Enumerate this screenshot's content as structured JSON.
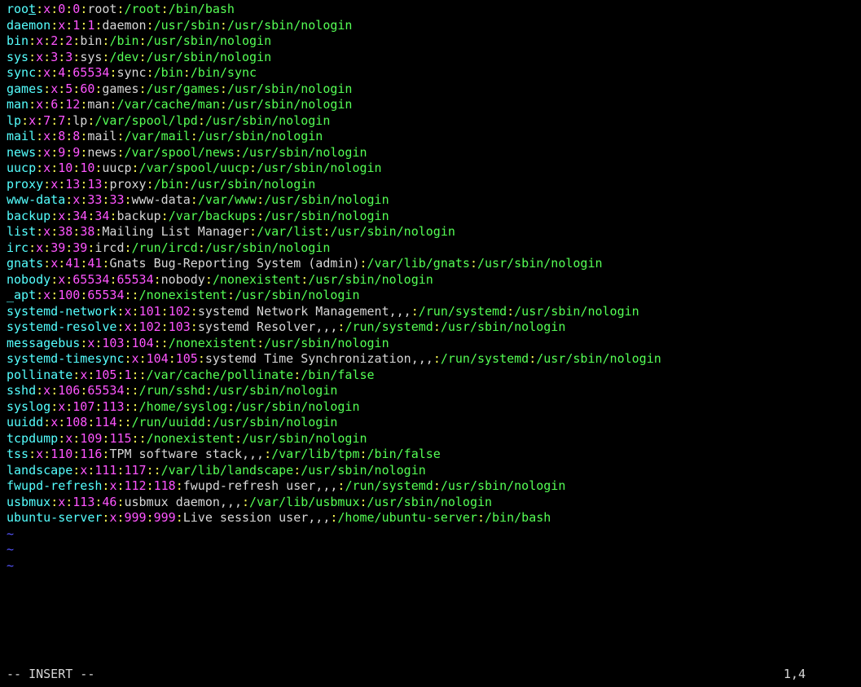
{
  "passwd": [
    {
      "user": "root",
      "pw": "x",
      "uid": "0",
      "gid": "0",
      "gecos": "root",
      "home": "/root",
      "shell": "/bin/bash"
    },
    {
      "user": "daemon",
      "pw": "x",
      "uid": "1",
      "gid": "1",
      "gecos": "daemon",
      "home": "/usr/sbin",
      "shell": "/usr/sbin/nologin"
    },
    {
      "user": "bin",
      "pw": "x",
      "uid": "2",
      "gid": "2",
      "gecos": "bin",
      "home": "/bin",
      "shell": "/usr/sbin/nologin"
    },
    {
      "user": "sys",
      "pw": "x",
      "uid": "3",
      "gid": "3",
      "gecos": "sys",
      "home": "/dev",
      "shell": "/usr/sbin/nologin"
    },
    {
      "user": "sync",
      "pw": "x",
      "uid": "4",
      "gid": "65534",
      "gecos": "sync",
      "home": "/bin",
      "shell": "/bin/sync"
    },
    {
      "user": "games",
      "pw": "x",
      "uid": "5",
      "gid": "60",
      "gecos": "games",
      "home": "/usr/games",
      "shell": "/usr/sbin/nologin"
    },
    {
      "user": "man",
      "pw": "x",
      "uid": "6",
      "gid": "12",
      "gecos": "man",
      "home": "/var/cache/man",
      "shell": "/usr/sbin/nologin"
    },
    {
      "user": "lp",
      "pw": "x",
      "uid": "7",
      "gid": "7",
      "gecos": "lp",
      "home": "/var/spool/lpd",
      "shell": "/usr/sbin/nologin"
    },
    {
      "user": "mail",
      "pw": "x",
      "uid": "8",
      "gid": "8",
      "gecos": "mail",
      "home": "/var/mail",
      "shell": "/usr/sbin/nologin"
    },
    {
      "user": "news",
      "pw": "x",
      "uid": "9",
      "gid": "9",
      "gecos": "news",
      "home": "/var/spool/news",
      "shell": "/usr/sbin/nologin"
    },
    {
      "user": "uucp",
      "pw": "x",
      "uid": "10",
      "gid": "10",
      "gecos": "uucp",
      "home": "/var/spool/uucp",
      "shell": "/usr/sbin/nologin"
    },
    {
      "user": "proxy",
      "pw": "x",
      "uid": "13",
      "gid": "13",
      "gecos": "proxy",
      "home": "/bin",
      "shell": "/usr/sbin/nologin"
    },
    {
      "user": "www-data",
      "pw": "x",
      "uid": "33",
      "gid": "33",
      "gecos": "www-data",
      "home": "/var/www",
      "shell": "/usr/sbin/nologin"
    },
    {
      "user": "backup",
      "pw": "x",
      "uid": "34",
      "gid": "34",
      "gecos": "backup",
      "home": "/var/backups",
      "shell": "/usr/sbin/nologin"
    },
    {
      "user": "list",
      "pw": "x",
      "uid": "38",
      "gid": "38",
      "gecos": "Mailing List Manager",
      "home": "/var/list",
      "shell": "/usr/sbin/nologin"
    },
    {
      "user": "irc",
      "pw": "x",
      "uid": "39",
      "gid": "39",
      "gecos": "ircd",
      "home": "/run/ircd",
      "shell": "/usr/sbin/nologin"
    },
    {
      "user": "gnats",
      "pw": "x",
      "uid": "41",
      "gid": "41",
      "gecos": "Gnats Bug-Reporting System (admin)",
      "home": "/var/lib/gnats",
      "shell": "/usr/sbin/nologin"
    },
    {
      "user": "nobody",
      "pw": "x",
      "uid": "65534",
      "gid": "65534",
      "gecos": "nobody",
      "home": "/nonexistent",
      "shell": "/usr/sbin/nologin"
    },
    {
      "user": "_apt",
      "pw": "x",
      "uid": "100",
      "gid": "65534",
      "gecos": "",
      "home": "/nonexistent",
      "shell": "/usr/sbin/nologin"
    },
    {
      "user": "systemd-network",
      "pw": "x",
      "uid": "101",
      "gid": "102",
      "gecos": "systemd Network Management,,,",
      "home": "/run/systemd",
      "shell": "/usr/sbin/nologin"
    },
    {
      "user": "systemd-resolve",
      "pw": "x",
      "uid": "102",
      "gid": "103",
      "gecos": "systemd Resolver,,,",
      "home": "/run/systemd",
      "shell": "/usr/sbin/nologin"
    },
    {
      "user": "messagebus",
      "pw": "x",
      "uid": "103",
      "gid": "104",
      "gecos": "",
      "home": "/nonexistent",
      "shell": "/usr/sbin/nologin"
    },
    {
      "user": "systemd-timesync",
      "pw": "x",
      "uid": "104",
      "gid": "105",
      "gecos": "systemd Time Synchronization,,,",
      "home": "/run/systemd",
      "shell": "/usr/sbin/nologin"
    },
    {
      "user": "pollinate",
      "pw": "x",
      "uid": "105",
      "gid": "1",
      "gecos": "",
      "home": "/var/cache/pollinate",
      "shell": "/bin/false"
    },
    {
      "user": "sshd",
      "pw": "x",
      "uid": "106",
      "gid": "65534",
      "gecos": "",
      "home": "/run/sshd",
      "shell": "/usr/sbin/nologin"
    },
    {
      "user": "syslog",
      "pw": "x",
      "uid": "107",
      "gid": "113",
      "gecos": "",
      "home": "/home/syslog",
      "shell": "/usr/sbin/nologin"
    },
    {
      "user": "uuidd",
      "pw": "x",
      "uid": "108",
      "gid": "114",
      "gecos": "",
      "home": "/run/uuidd",
      "shell": "/usr/sbin/nologin"
    },
    {
      "user": "tcpdump",
      "pw": "x",
      "uid": "109",
      "gid": "115",
      "gecos": "",
      "home": "/nonexistent",
      "shell": "/usr/sbin/nologin"
    },
    {
      "user": "tss",
      "pw": "x",
      "uid": "110",
      "gid": "116",
      "gecos": "TPM software stack,,,",
      "home": "/var/lib/tpm",
      "shell": "/bin/false"
    },
    {
      "user": "landscape",
      "pw": "x",
      "uid": "111",
      "gid": "117",
      "gecos": "",
      "home": "/var/lib/landscape",
      "shell": "/usr/sbin/nologin"
    },
    {
      "user": "fwupd-refresh",
      "pw": "x",
      "uid": "112",
      "gid": "118",
      "gecos": "fwupd-refresh user,,,",
      "home": "/run/systemd",
      "shell": "/usr/sbin/nologin"
    },
    {
      "user": "usbmux",
      "pw": "x",
      "uid": "113",
      "gid": "46",
      "gecos": "usbmux daemon,,,",
      "home": "/var/lib/usbmux",
      "shell": "/usr/sbin/nologin"
    },
    {
      "user": "ubuntu-server",
      "pw": "x",
      "uid": "999",
      "gid": "999",
      "gecos": "Live session user,,,",
      "home": "/home/ubuntu-server",
      "shell": "/bin/bash"
    }
  ],
  "cursor_row": 0,
  "cursor_col": 3,
  "empty_lines": 3,
  "tilde": "~",
  "status": {
    "mode": "-- INSERT --",
    "position": "1,4"
  },
  "sep": ":"
}
